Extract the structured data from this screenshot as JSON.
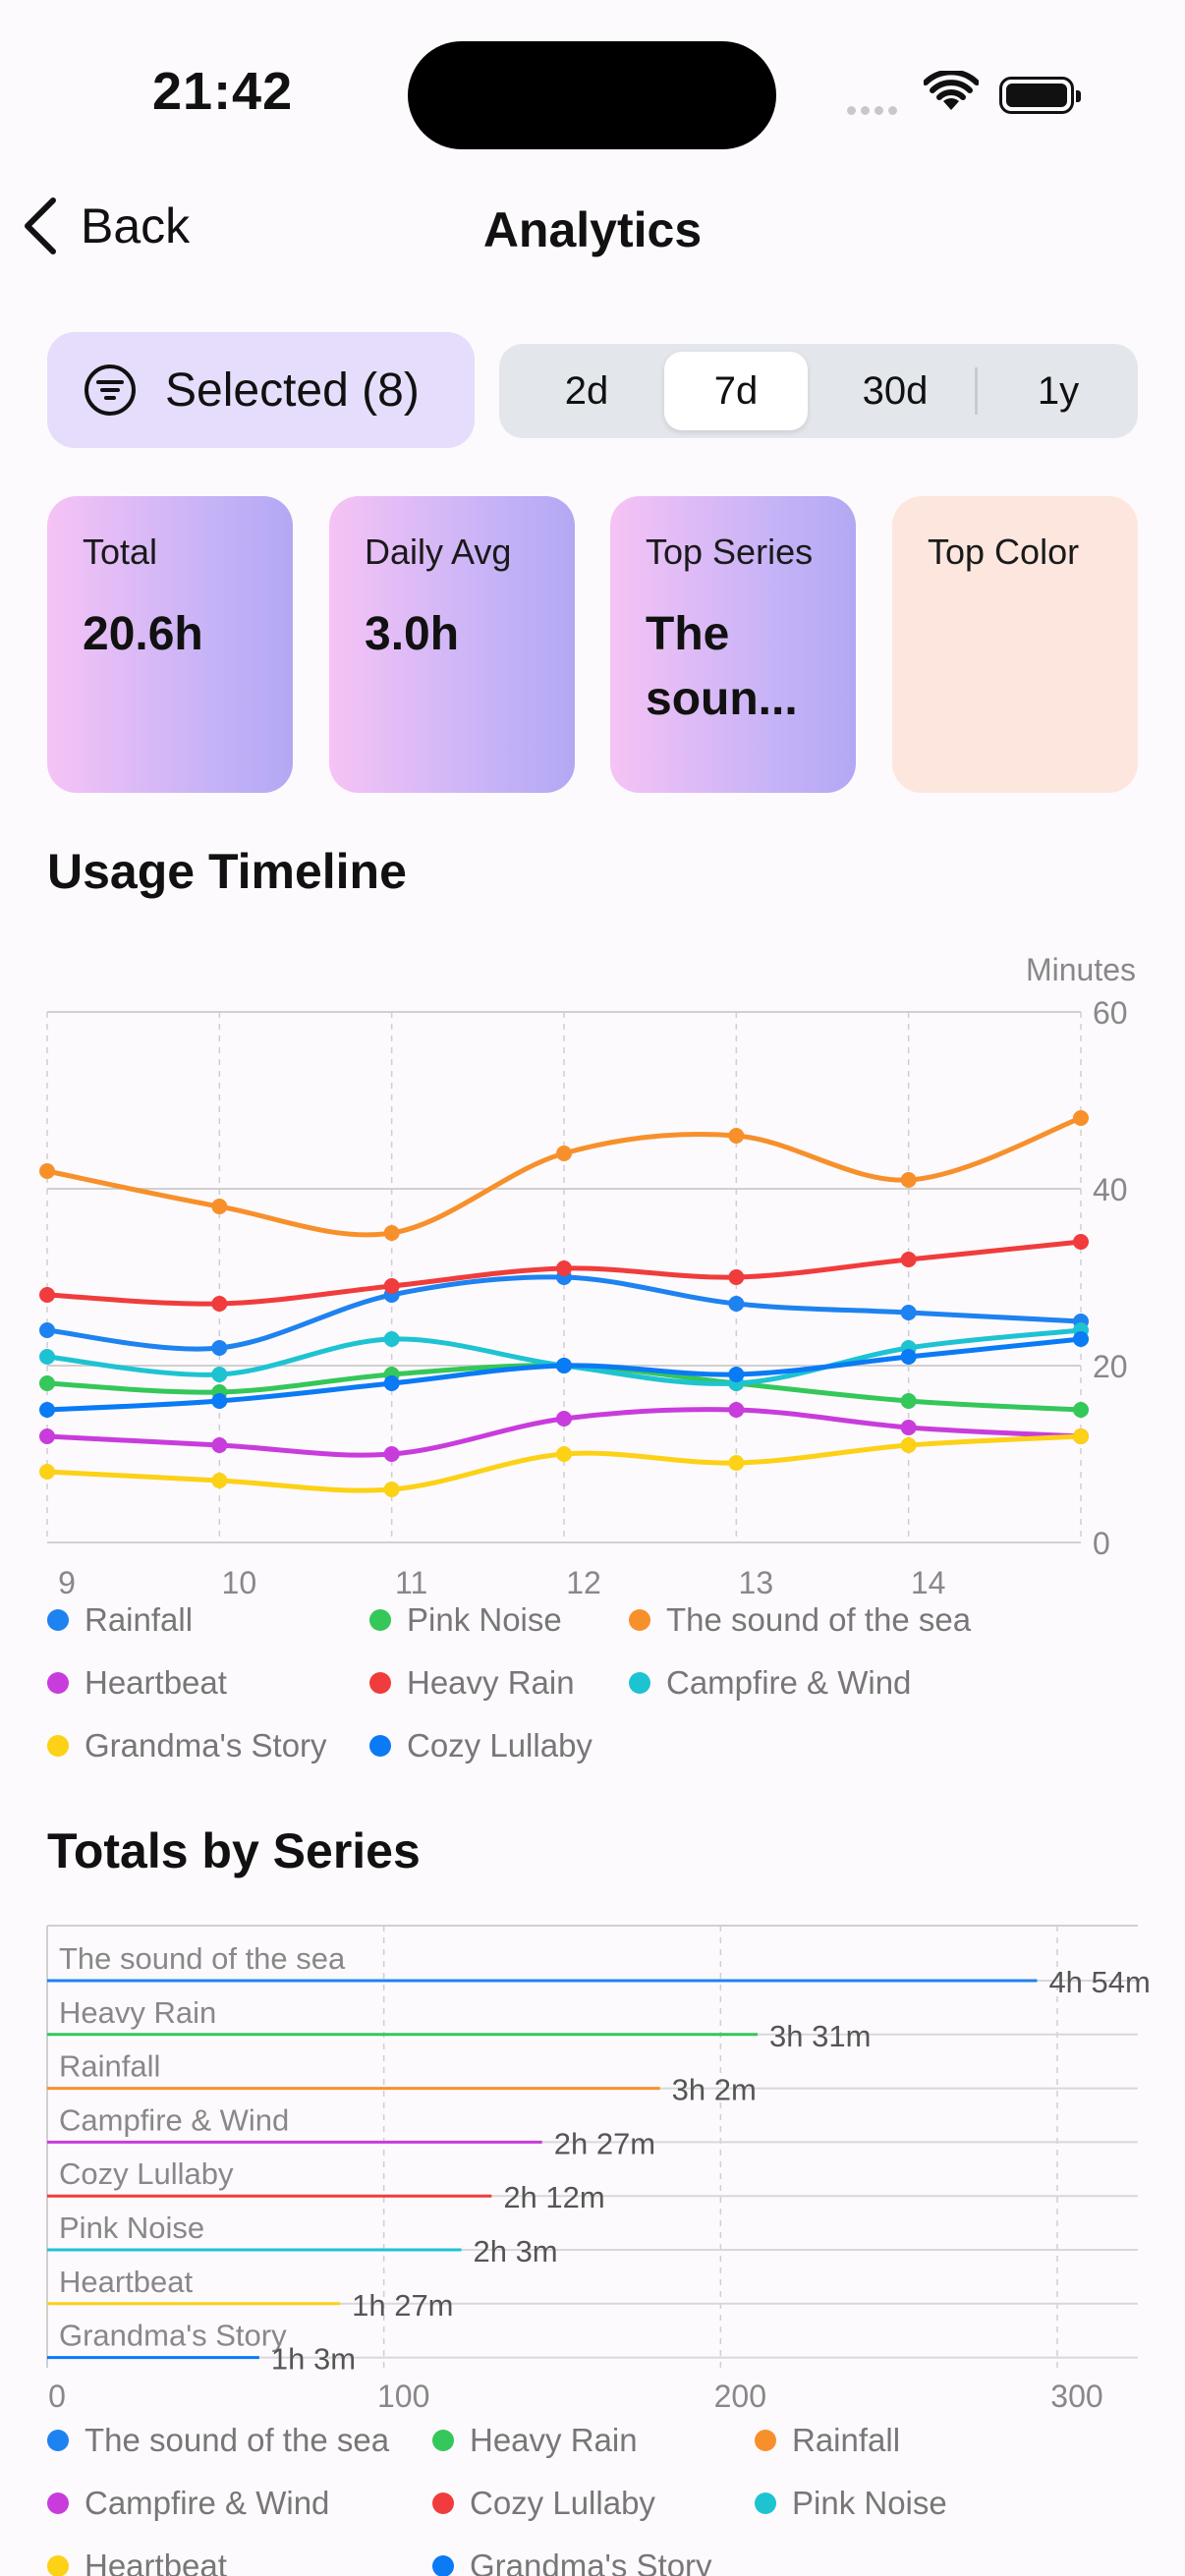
{
  "status": {
    "time": "21:42"
  },
  "nav": {
    "back_label": "Back",
    "title": "Analytics"
  },
  "filter": {
    "selected_label": "Selected (8)",
    "ranges": [
      "2d",
      "7d",
      "30d",
      "1y"
    ],
    "active_range": "7d"
  },
  "cards": [
    {
      "label": "Total",
      "value": "20.6h"
    },
    {
      "label": "Daily Avg",
      "value": "3.0h"
    },
    {
      "label": "Top Series",
      "value": "The soun..."
    },
    {
      "label": "Top Color",
      "value": ""
    }
  ],
  "timeline": {
    "title": "Usage Timeline"
  },
  "totals": {
    "title": "Totals by Series"
  },
  "chart_data": [
    {
      "type": "line",
      "title": "Usage Timeline",
      "ylabel": "Minutes",
      "ylim": [
        0,
        60
      ],
      "yticks": [
        0,
        20,
        40,
        60
      ],
      "xlim": [
        9,
        15
      ],
      "x": [
        9,
        10,
        11,
        12,
        13,
        14,
        15
      ],
      "xtick_labels": [
        "9",
        "10",
        "11",
        "12",
        "13",
        "14"
      ],
      "grid": true,
      "legend_position": "bottom",
      "series": [
        {
          "name": "Rainfall",
          "color": "#1e82f0",
          "values": [
            24,
            22,
            28,
            30,
            27,
            26,
            25
          ]
        },
        {
          "name": "Pink Noise",
          "color": "#34c759",
          "values": [
            18,
            17,
            19,
            20,
            18,
            16,
            15
          ]
        },
        {
          "name": "The sound of the sea",
          "color": "#f7902b",
          "values": [
            42,
            38,
            35,
            44,
            46,
            41,
            48
          ]
        },
        {
          "name": "Heartbeat",
          "color": "#c83cdc",
          "values": [
            12,
            11,
            10,
            14,
            15,
            13,
            12
          ]
        },
        {
          "name": "Heavy Rain",
          "color": "#f03c3c",
          "values": [
            28,
            27,
            29,
            31,
            30,
            32,
            34
          ]
        },
        {
          "name": "Campfire & Wind",
          "color": "#1ec3d2",
          "values": [
            21,
            19,
            23,
            20,
            18,
            22,
            24
          ]
        },
        {
          "name": "Grandma's Story",
          "color": "#fcd116",
          "values": [
            8,
            7,
            6,
            10,
            9,
            11,
            12
          ]
        },
        {
          "name": "Cozy Lullaby",
          "color": "#0a7af5",
          "values": [
            15,
            16,
            18,
            20,
            19,
            21,
            23
          ]
        }
      ]
    },
    {
      "type": "bar",
      "orientation": "horizontal",
      "title": "Totals by Series",
      "xlim": [
        0,
        320
      ],
      "xticks": [
        0,
        100,
        200,
        300
      ],
      "grid": true,
      "legend_position": "bottom",
      "categories": [
        "The sound of the sea",
        "Heavy Rain",
        "Rainfall",
        "Campfire & Wind",
        "Cozy Lullaby",
        "Pink Noise",
        "Heartbeat",
        "Grandma's Story"
      ],
      "values": [
        294,
        211,
        182,
        147,
        132,
        123,
        87,
        63
      ],
      "value_labels": [
        "4h 54m",
        "3h 31m",
        "3h 2m",
        "2h 27m",
        "2h 12m",
        "2h 3m",
        "1h 27m",
        "1h 3m"
      ],
      "colors": [
        "#1e82f0",
        "#34c759",
        "#f7902b",
        "#c83cdc",
        "#f03c3c",
        "#1ec3d2",
        "#fcd116",
        "#0a7af5"
      ]
    }
  ]
}
